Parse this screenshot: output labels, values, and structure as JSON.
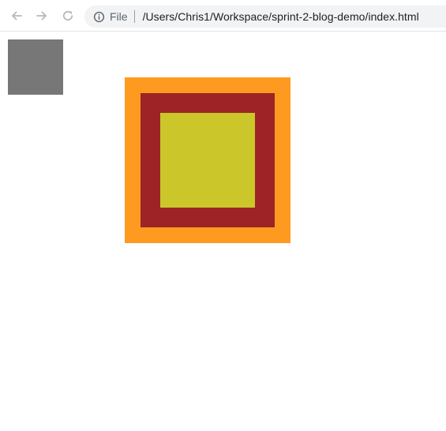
{
  "browser": {
    "address_bar": {
      "scheme_label": "File",
      "url": "/Users/Chris1/Workspace/sprint-2-blog-demo/index.html"
    },
    "icons": {
      "back": "arrow-left-icon",
      "forward": "arrow-right-icon",
      "reload": "reload-icon",
      "info": "info-icon"
    }
  },
  "page": {
    "colors": {
      "small_box": "#777777",
      "outer_box": "#ff9a21",
      "middle_box": "#9e2326",
      "inner_box": "#cbc72a"
    }
  }
}
